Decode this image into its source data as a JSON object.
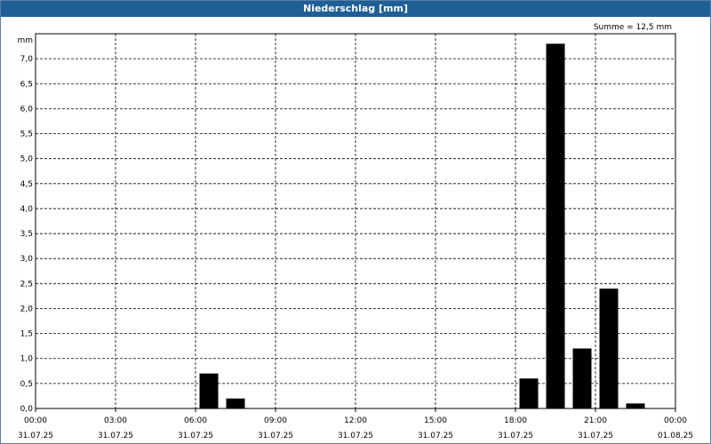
{
  "window": {
    "title": "Niederschlag [mm]"
  },
  "colors": {
    "titlebar": "#1e5f96",
    "bars": "#000000",
    "grid": "#000000",
    "background": "#ffffff"
  },
  "chart_data": {
    "type": "bar",
    "title": "Niederschlag [mm]",
    "ylabel": "mm",
    "xlabel": "",
    "summary": "Summe = 12,5 mm",
    "ylim": [
      0,
      7.5
    ],
    "y_ticks": [
      "0,0",
      "0,5",
      "1,0",
      "1,5",
      "2,0",
      "2,5",
      "3,0",
      "3,5",
      "4,0",
      "4,5",
      "5,0",
      "5,5",
      "6,0",
      "6,5",
      "7,0"
    ],
    "x_ticks": [
      {
        "time": "00:00",
        "date": "31.07.25"
      },
      {
        "time": "03:00",
        "date": "31.07.25"
      },
      {
        "time": "06:00",
        "date": "31.07.25"
      },
      {
        "time": "09:00",
        "date": "31.07.25"
      },
      {
        "time": "12:00",
        "date": "31.07.25"
      },
      {
        "time": "15:00",
        "date": "31.07.25"
      },
      {
        "time": "18:00",
        "date": "31.07.25"
      },
      {
        "time": "21:00",
        "date": "31.07.25"
      },
      {
        "time": "00:00",
        "date": "01.08.25"
      }
    ],
    "grid": true,
    "series": [
      {
        "values": [
          {
            "hour": 6,
            "value": 0.7
          },
          {
            "hour": 7,
            "value": 0.2
          },
          {
            "hour": 18,
            "value": 0.6
          },
          {
            "hour": 19,
            "value": 7.3
          },
          {
            "hour": 20,
            "value": 1.2
          },
          {
            "hour": 21,
            "value": 2.4
          },
          {
            "hour": 22,
            "value": 0.1
          }
        ]
      }
    ]
  }
}
